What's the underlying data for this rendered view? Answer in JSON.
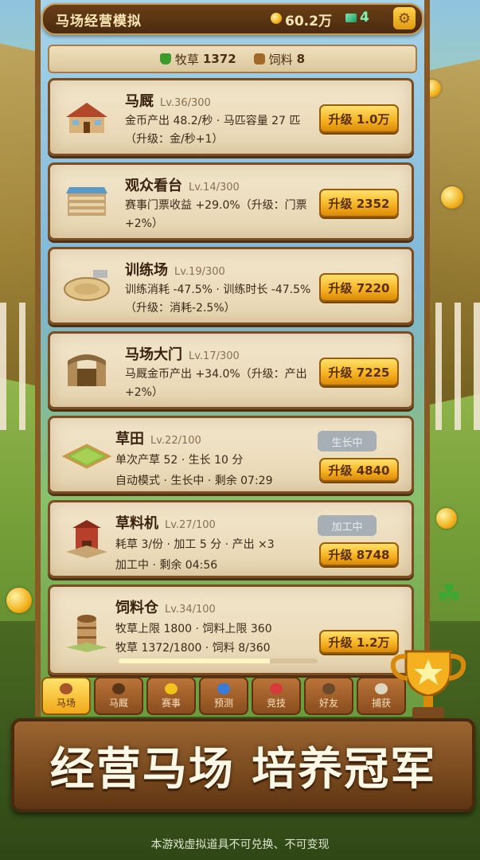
{
  "header": {
    "title": "马场经营模拟",
    "coins": "60.2万",
    "gems": "4"
  },
  "resources": {
    "grass_label": "牧草",
    "grass_value": "1372",
    "feed_label": "饲料",
    "feed_value": "8"
  },
  "cards": [
    {
      "name": "马厩",
      "level": "Lv.36/300",
      "desc": "金币产出 48.2/秒 · 马匹容量 27 匹（升级：金/秒+1）",
      "button": "升级 1.0万"
    },
    {
      "name": "观众看台",
      "level": "Lv.14/300",
      "desc": "赛事门票收益 +29.0%（升级：门票+2%）",
      "button": "升级 2352"
    },
    {
      "name": "训练场",
      "level": "Lv.19/300",
      "desc": "训练消耗 -47.5% · 训练时长 -47.5%（升级：消耗-2.5%）",
      "button": "升级 7220"
    },
    {
      "name": "马场大门",
      "level": "Lv.17/300",
      "desc": "马厩金币产出 +34.0%（升级：产出+2%）",
      "button": "升级 7225"
    },
    {
      "name": "草田",
      "level": "Lv.22/100",
      "line1": "单次产草 52 · 生长 10 分",
      "line2": "自动模式 · 生长中 · 剩余 07:29",
      "status": "生长中",
      "button": "升级 4840"
    },
    {
      "name": "草料机",
      "level": "Lv.27/100",
      "line1": "耗草 3/份 · 加工 5 分 · 产出 ×3",
      "line2": "加工中 · 剩余 04:56",
      "status": "加工中",
      "button": "升级 8748"
    },
    {
      "name": "饲料仓",
      "level": "Lv.34/100",
      "line1": "牧草上限 1800 · 饲料上限 360",
      "line2": "牧草 1372/1800 · 饲料 8/360",
      "button": "升级 1.2万",
      "progress": 0.76
    }
  ],
  "tabs": [
    "马场",
    "马厩",
    "赛事",
    "预测",
    "竞技",
    "好友",
    "捕获"
  ],
  "banner": "经营马场 培养冠军",
  "disclaimer": "本游戏虚拟道具不可兑换、不可变现",
  "colors": {
    "accent": "#f5b020",
    "wood": "#7a4e22",
    "parchment": "#efdfbd"
  }
}
